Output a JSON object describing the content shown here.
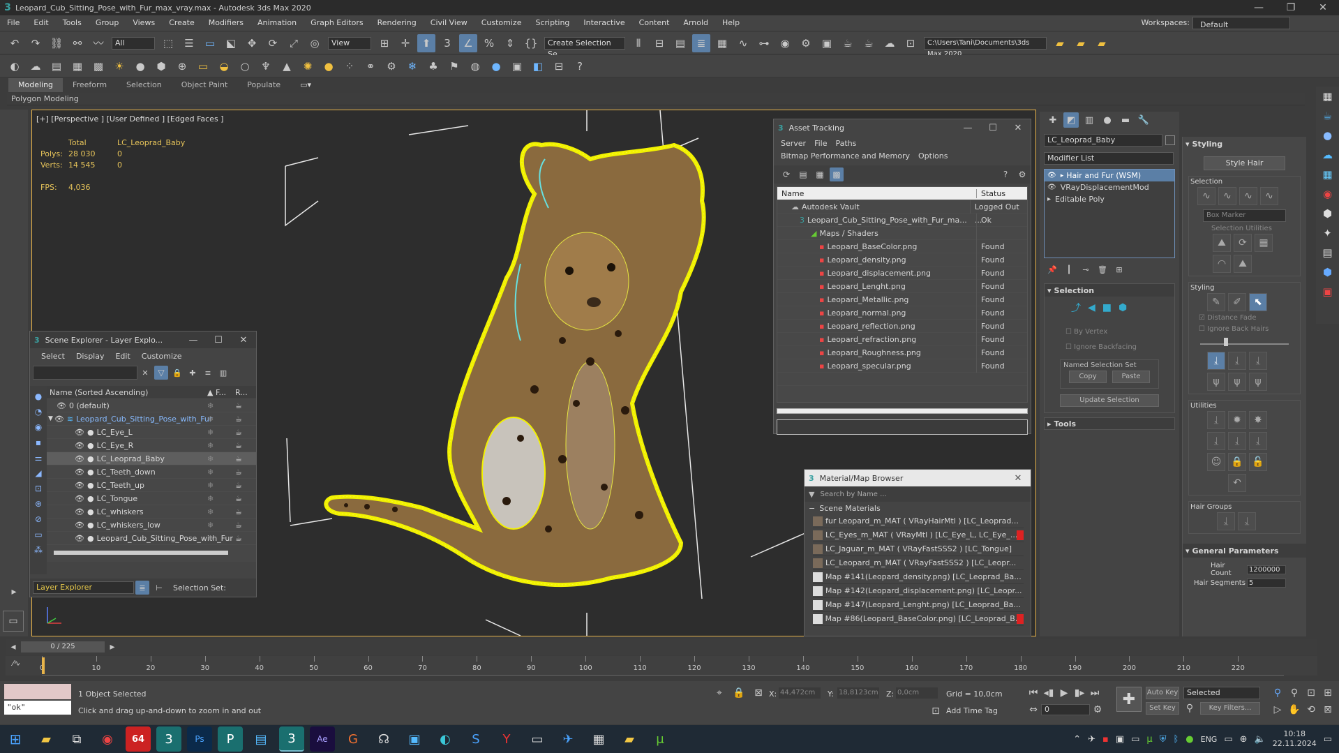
{
  "window": {
    "title": "Leopard_Cub_Sitting_Pose_with_Fur_max_vray.max - Autodesk 3ds Max 2020",
    "workspaces_label": "Workspaces:",
    "workspace_value": "Default"
  },
  "menu": [
    "File",
    "Edit",
    "Tools",
    "Group",
    "Views",
    "Create",
    "Modifiers",
    "Animation",
    "Graph Editors",
    "Rendering",
    "Civil View",
    "Customize",
    "Scripting",
    "Interactive",
    "Content",
    "Arnold",
    "Help"
  ],
  "toolbar": {
    "filter_value": "All",
    "refcoord_value": "View",
    "selection_set_value": "Create Selection Se",
    "project_path": "C:\\Users\\Tani\\Documents\\3ds Max 2020"
  },
  "ribbon": {
    "tabs": [
      "Modeling",
      "Freeform",
      "Selection",
      "Object Paint",
      "Populate"
    ],
    "subtab": "Polygon Modeling"
  },
  "viewport": {
    "label": "[+] [Perspective ] [User Defined ] [Edged Faces ]",
    "stats": {
      "total_label": "Total",
      "object_label": "LC_Leoprad_Baby",
      "polys_label": "Polys:",
      "polys_total": "28 030",
      "polys_obj": "0",
      "verts_label": "Verts:",
      "verts_total": "14 545",
      "verts_obj": "0",
      "fps_label": "FPS:",
      "fps_value": "4,036"
    }
  },
  "asset_tracking": {
    "title": "Asset Tracking",
    "menu": [
      "Server",
      "File",
      "Paths",
      "Bitmap Performance and Memory",
      "Options"
    ],
    "col_name": "Name",
    "col_status": "Status",
    "rows": [
      {
        "name": "Autodesk Vault",
        "status": "Logged Out ..."
      },
      {
        "name": "Leopard_Cub_Sitting_Pose_with_Fur_ma...",
        "status": "Ok"
      },
      {
        "name": "Maps / Shaders",
        "status": ""
      },
      {
        "name": "Leopard_BaseColor.png",
        "status": "Found"
      },
      {
        "name": "Leopard_density.png",
        "status": "Found"
      },
      {
        "name": "Leopard_displacement.png",
        "status": "Found"
      },
      {
        "name": "Leopard_Lenght.png",
        "status": "Found"
      },
      {
        "name": "Leopard_Metallic.png",
        "status": "Found"
      },
      {
        "name": "Leopard_normal.png",
        "status": "Found"
      },
      {
        "name": "Leopard_reflection.png",
        "status": "Found"
      },
      {
        "name": "Leopard_refraction.png",
        "status": "Found"
      },
      {
        "name": "Leopard_Roughness.png",
        "status": "Found"
      },
      {
        "name": "Leopard_specular.png",
        "status": "Found"
      }
    ]
  },
  "scene_explorer": {
    "title": "Scene Explorer - Layer Explo...",
    "menu": [
      "Select",
      "Display",
      "Edit",
      "Customize"
    ],
    "col_name": "Name (Sorted Ascending)",
    "col_f": "▲ F...",
    "col_r": "R...",
    "items": [
      {
        "name": "0 (default)"
      },
      {
        "name": "Leopard_Cub_Sitting_Pose_with_Fur"
      },
      {
        "name": "LC_Eye_L"
      },
      {
        "name": "LC_Eye_R"
      },
      {
        "name": "LC_Leoprad_Baby"
      },
      {
        "name": "LC_Teeth_down"
      },
      {
        "name": "LC_Teeth_up"
      },
      {
        "name": "LC_Tongue"
      },
      {
        "name": "LC_whiskers"
      },
      {
        "name": "LC_whiskers_low"
      },
      {
        "name": "Leopard_Cub_Sitting_Pose_with_Fur"
      }
    ],
    "footer_explorer": "Layer Explorer",
    "footer_selset": "Selection Set:"
  },
  "material_browser": {
    "title": "Material/Map Browser",
    "search_placeholder": "Search by Name ...",
    "group": "Scene Materials",
    "items": [
      "fur Leopard_m_MAT ( VRayHairMtl ) [LC_Leoprad...",
      "LC_Eyes_m_MAT ( VRayMtl ) [LC_Eye_L, LC_Eye_...",
      "LC_Jaguar_m_MAT ( VRayFastSSS2 ) [LC_Tongue]",
      "LC_Leopard_m_MAT ( VRayFastSSS2 ) [LC_Leopr...",
      "Map #141(Leopard_density.png) [LC_Leoprad_Ba...",
      "Map #142(Leopard_displacement.png) [LC_Leopr...",
      "Map #147(Leopard_Lenght.png) [LC_Leoprad_Ba...",
      "Map #86(Leopard_BaseColor.png) [LC_Leoprad_B..."
    ]
  },
  "command_panel": {
    "object_name": "LC_Leoprad_Baby",
    "modifier_list": "Modifier List",
    "stack": [
      "Hair and Fur (WSM)",
      "VRayDisplacementMod",
      "Editable Poly"
    ],
    "selection_rollout": "Selection",
    "by_vertex": "By Vertex",
    "ignore_backfacing": "Ignore Backfacing",
    "named_selection_set": "Named Selection Set",
    "copy": "Copy",
    "paste": "Paste",
    "update_selection": "Update Selection",
    "tools_rollout": "Tools"
  },
  "styling_panel": {
    "title": "Styling",
    "style_hair": "Style Hair",
    "selection_label": "Selection",
    "box_marker": "Box Marker",
    "selection_utilities": "Selection Utilities",
    "styling_label": "Styling",
    "distance_fade": "Distance Fade",
    "ignore_back_hairs": "Ignore Back Hairs",
    "utilities_label": "Utilities",
    "hair_groups_label": "Hair Groups",
    "general_parameters": "General Parameters",
    "hair_count_label": "Hair Count",
    "hair_count_value": "1200000",
    "hair_segments_label": "Hair Segments",
    "hair_segments_value": "5"
  },
  "timeline": {
    "frame_label": "0 / 225",
    "ticks": [
      "0",
      "10",
      "20",
      "30",
      "40",
      "50",
      "60",
      "70",
      "80",
      "90",
      "100",
      "110",
      "120",
      "130",
      "140",
      "150",
      "160",
      "170",
      "180",
      "190",
      "200",
      "210",
      "220"
    ]
  },
  "status": {
    "maxscript_value": "\"ok\"",
    "objects_selected": "1 Object Selected",
    "prompt": "Click and drag up-and-down to zoom in and out",
    "x_label": "X:",
    "x_value": "44,472cm",
    "y_label": "Y:",
    "y_value": "18,8123cm",
    "z_label": "Z:",
    "z_value": "0,0cm",
    "grid": "Grid = 10,0cm",
    "add_time_tag": "Add Time Tag",
    "auto_key": "Auto Key",
    "set_key": "Set Key",
    "selected": "Selected",
    "key_filters": "Key Filters...",
    "frame_value": "0"
  },
  "taskbar": {
    "lang": "ENG",
    "time": "10:18",
    "date": "22.11.2024",
    "badge": "64"
  }
}
